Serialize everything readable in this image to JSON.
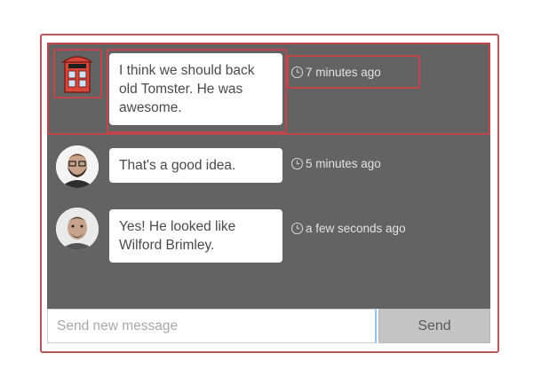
{
  "messages": [
    {
      "avatar_icon": "red-telephone-booth-icon",
      "text": "I think we should back old Tomster. He was awesome.",
      "time": "7 minutes ago"
    },
    {
      "avatar_icon": "bearded-man-avatar",
      "text": "That's a good idea.",
      "time": "5 minutes ago"
    },
    {
      "avatar_icon": "smiling-man-avatar",
      "text": "Yes! He looked like Wilford Brimley.",
      "time": "a few seconds ago"
    }
  ],
  "composer": {
    "placeholder": "Send new message",
    "value": "",
    "send_label": "Send"
  },
  "colors": {
    "accent_highlight": "#c0464d",
    "chat_background": "#636363"
  }
}
